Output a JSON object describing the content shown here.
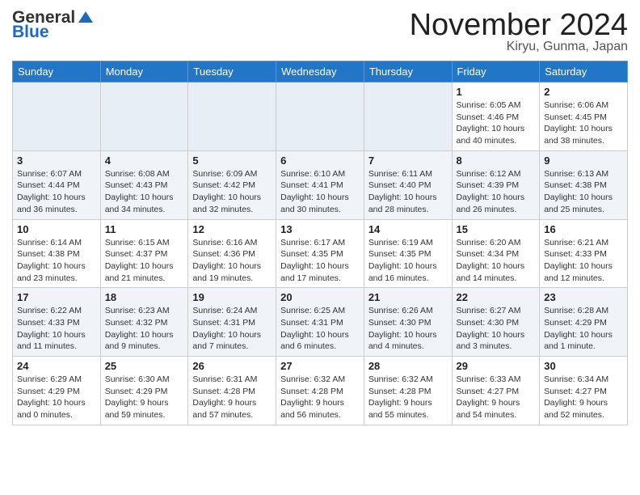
{
  "logo": {
    "general": "General",
    "blue": "Blue"
  },
  "title": "November 2024",
  "location": "Kiryu, Gunma, Japan",
  "days_of_week": [
    "Sunday",
    "Monday",
    "Tuesday",
    "Wednesday",
    "Thursday",
    "Friday",
    "Saturday"
  ],
  "weeks": [
    [
      {
        "day": "",
        "info": ""
      },
      {
        "day": "",
        "info": ""
      },
      {
        "day": "",
        "info": ""
      },
      {
        "day": "",
        "info": ""
      },
      {
        "day": "",
        "info": ""
      },
      {
        "day": "1",
        "info": "Sunrise: 6:05 AM\nSunset: 4:46 PM\nDaylight: 10 hours and 40 minutes."
      },
      {
        "day": "2",
        "info": "Sunrise: 6:06 AM\nSunset: 4:45 PM\nDaylight: 10 hours and 38 minutes."
      }
    ],
    [
      {
        "day": "3",
        "info": "Sunrise: 6:07 AM\nSunset: 4:44 PM\nDaylight: 10 hours and 36 minutes."
      },
      {
        "day": "4",
        "info": "Sunrise: 6:08 AM\nSunset: 4:43 PM\nDaylight: 10 hours and 34 minutes."
      },
      {
        "day": "5",
        "info": "Sunrise: 6:09 AM\nSunset: 4:42 PM\nDaylight: 10 hours and 32 minutes."
      },
      {
        "day": "6",
        "info": "Sunrise: 6:10 AM\nSunset: 4:41 PM\nDaylight: 10 hours and 30 minutes."
      },
      {
        "day": "7",
        "info": "Sunrise: 6:11 AM\nSunset: 4:40 PM\nDaylight: 10 hours and 28 minutes."
      },
      {
        "day": "8",
        "info": "Sunrise: 6:12 AM\nSunset: 4:39 PM\nDaylight: 10 hours and 26 minutes."
      },
      {
        "day": "9",
        "info": "Sunrise: 6:13 AM\nSunset: 4:38 PM\nDaylight: 10 hours and 25 minutes."
      }
    ],
    [
      {
        "day": "10",
        "info": "Sunrise: 6:14 AM\nSunset: 4:38 PM\nDaylight: 10 hours and 23 minutes."
      },
      {
        "day": "11",
        "info": "Sunrise: 6:15 AM\nSunset: 4:37 PM\nDaylight: 10 hours and 21 minutes."
      },
      {
        "day": "12",
        "info": "Sunrise: 6:16 AM\nSunset: 4:36 PM\nDaylight: 10 hours and 19 minutes."
      },
      {
        "day": "13",
        "info": "Sunrise: 6:17 AM\nSunset: 4:35 PM\nDaylight: 10 hours and 17 minutes."
      },
      {
        "day": "14",
        "info": "Sunrise: 6:19 AM\nSunset: 4:35 PM\nDaylight: 10 hours and 16 minutes."
      },
      {
        "day": "15",
        "info": "Sunrise: 6:20 AM\nSunset: 4:34 PM\nDaylight: 10 hours and 14 minutes."
      },
      {
        "day": "16",
        "info": "Sunrise: 6:21 AM\nSunset: 4:33 PM\nDaylight: 10 hours and 12 minutes."
      }
    ],
    [
      {
        "day": "17",
        "info": "Sunrise: 6:22 AM\nSunset: 4:33 PM\nDaylight: 10 hours and 11 minutes."
      },
      {
        "day": "18",
        "info": "Sunrise: 6:23 AM\nSunset: 4:32 PM\nDaylight: 10 hours and 9 minutes."
      },
      {
        "day": "19",
        "info": "Sunrise: 6:24 AM\nSunset: 4:31 PM\nDaylight: 10 hours and 7 minutes."
      },
      {
        "day": "20",
        "info": "Sunrise: 6:25 AM\nSunset: 4:31 PM\nDaylight: 10 hours and 6 minutes."
      },
      {
        "day": "21",
        "info": "Sunrise: 6:26 AM\nSunset: 4:30 PM\nDaylight: 10 hours and 4 minutes."
      },
      {
        "day": "22",
        "info": "Sunrise: 6:27 AM\nSunset: 4:30 PM\nDaylight: 10 hours and 3 minutes."
      },
      {
        "day": "23",
        "info": "Sunrise: 6:28 AM\nSunset: 4:29 PM\nDaylight: 10 hours and 1 minute."
      }
    ],
    [
      {
        "day": "24",
        "info": "Sunrise: 6:29 AM\nSunset: 4:29 PM\nDaylight: 10 hours and 0 minutes."
      },
      {
        "day": "25",
        "info": "Sunrise: 6:30 AM\nSunset: 4:29 PM\nDaylight: 9 hours and 59 minutes."
      },
      {
        "day": "26",
        "info": "Sunrise: 6:31 AM\nSunset: 4:28 PM\nDaylight: 9 hours and 57 minutes."
      },
      {
        "day": "27",
        "info": "Sunrise: 6:32 AM\nSunset: 4:28 PM\nDaylight: 9 hours and 56 minutes."
      },
      {
        "day": "28",
        "info": "Sunrise: 6:32 AM\nSunset: 4:28 PM\nDaylight: 9 hours and 55 minutes."
      },
      {
        "day": "29",
        "info": "Sunrise: 6:33 AM\nSunset: 4:27 PM\nDaylight: 9 hours and 54 minutes."
      },
      {
        "day": "30",
        "info": "Sunrise: 6:34 AM\nSunset: 4:27 PM\nDaylight: 9 hours and 52 minutes."
      }
    ]
  ]
}
